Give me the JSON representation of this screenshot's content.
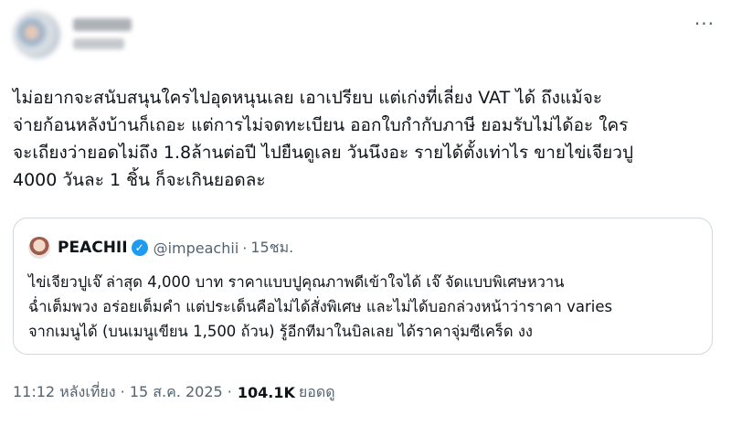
{
  "header": {
    "more_label": "···"
  },
  "tweet": {
    "lines": [
      "ไม่อยากจะสนับสนุนใครไปอุดหนุนเลย เอาเปรียบ แต่เก่งที่เลี่ยง VAT ได้ ถึงแม้จะ",
      "จ่ายก้อนหลังบ้านก็เถอะ แต่การไม่จดทะเบียน ออกใบกำกับภาษี ยอมรับไม่ได้อะ ใคร",
      "จะเถียงว่ายอดไม่ถึง 1.8ล้านต่อปี ไปยืนดูเลย วันนึงอะ รายได้ตั้งเท่าไร ขายไข่เจียวปู",
      "4000 วันละ 1 ชิ้น ก็จะเกินยอดละ"
    ]
  },
  "quote": {
    "name": "PEACHII",
    "handle": "@impeachii",
    "separator": "·",
    "time": "15ชม.",
    "lines": [
      "ไข่เจียวปูเจ๊ ล่าสุด 4,000 บาท ราคาแบบปูคุณภาพดีเข้าใจได้ เจ๊ จัดแบบพิเศษหวาน",
      "ฉ่ำเต็มพวง อร่อยเต็มคำ แต่ประเด็นคือไม่ได้สั่งพิเศษ และไม่ได้บอกล่วงหน้าว่าราคา varies",
      "จากเมนูได้ (บนเมนูเขียน 1,500 ถ้วน) รู้อีกทีมาในบิลเลย ได้ราคาจุ่มซีเคร็ด งง"
    ]
  },
  "footer": {
    "timestamp": "11:12 หลังเที่ยง · 15 ส.ค. 2025 ·",
    "views_count": "104.1K",
    "views_label": "ยอดดู"
  }
}
